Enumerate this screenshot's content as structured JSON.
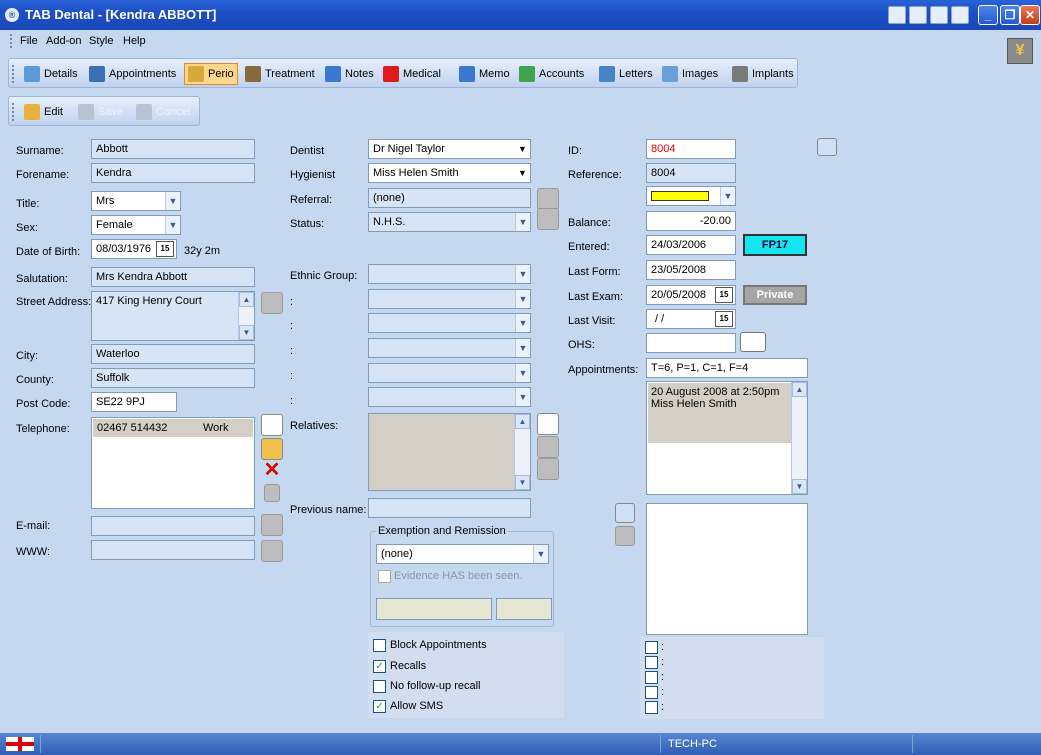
{
  "window": {
    "title": "TAB Dental - [Kendra ABBOTT]"
  },
  "menu": {
    "file": "File",
    "addon": "Add-on",
    "style": "Style",
    "help": "Help"
  },
  "tabs": [
    {
      "label": "Details",
      "icon": "house-icon"
    },
    {
      "label": "Appointments",
      "icon": "calendar-icon"
    },
    {
      "label": "Perio",
      "icon": "probe-icon",
      "active": true
    },
    {
      "label": "Treatment",
      "icon": "drill-icon"
    },
    {
      "label": "Notes",
      "icon": "notes-icon"
    },
    {
      "label": "Medical",
      "icon": "red-cross-icon"
    },
    {
      "label": "Memo",
      "icon": "memo-icon"
    },
    {
      "label": "Accounts",
      "icon": "money-icon"
    },
    {
      "label": "Letters",
      "icon": "letters-icon"
    },
    {
      "label": "Images",
      "icon": "images-icon"
    },
    {
      "label": "Implants",
      "icon": "implant-icon"
    }
  ],
  "edit_toolbar": {
    "edit": "Edit",
    "save": "Save",
    "cancel": "Cancel"
  },
  "patient": {
    "surname_label": "Surname:",
    "surname": "Abbott",
    "forename_label": "Forename:",
    "forename": "Kendra",
    "title_label": "Title:",
    "title": "Mrs",
    "sex_label": "Sex:",
    "sex": "Female",
    "dob_label": "Date of Birth:",
    "dob": "08/03/1976",
    "age": "32y 2m",
    "salutation_label": "Salutation:",
    "salutation": "Mrs Kendra Abbott",
    "street_label": "Street Address:",
    "street": "417 King Henry Court",
    "city_label": "City:",
    "city": "Waterloo",
    "county_label": "County:",
    "county": "Suffolk",
    "postcode_label": "Post Code:",
    "postcode": "SE22 9PJ",
    "telephone_label": "Telephone:",
    "telephone_number": "02467 514432",
    "telephone_type": "Work",
    "email_label": "E-mail:",
    "email": "",
    "www_label": "WWW:",
    "www": ""
  },
  "clinical": {
    "dentist_label": "Dentist",
    "dentist": "Dr Nigel Taylor",
    "hygienist_label": "Hygienist",
    "hygienist": "Miss Helen Smith",
    "referral_label": "Referral:",
    "referral": "(none)",
    "status_label": "Status:",
    "status": "N.H.S.",
    "ethnic_label": "Ethnic Group:",
    "colon": ":",
    "relatives_label": "Relatives:",
    "previous_name_label": "Previous name:",
    "exemption_title": "Exemption and Remission",
    "exemption_value": "(none)",
    "evidence_label": "Evidence HAS been seen.",
    "block_appointments": "Block Appointments",
    "recalls": "Recalls",
    "no_followup": "No follow-up recall",
    "allow_sms": "Allow SMS"
  },
  "account": {
    "id_label": "ID:",
    "id": "8004",
    "reference_label": "Reference:",
    "reference": "8004",
    "balance_label": "Balance:",
    "balance": "-20.00",
    "entered_label": "Entered:",
    "entered": "24/03/2006",
    "fp17": "FP17",
    "lastform_label": "Last Form:",
    "lastform": "23/05/2008",
    "lastexam_label": "Last Exam:",
    "lastexam": "20/05/2008",
    "private": "Private",
    "lastvisit_label": "Last Visit:",
    "lastvisit": "/ /",
    "ohs_label": "OHS:",
    "ohs": "",
    "appointments_label": "Appointments:",
    "appointments": "T=6, P=1, C=1, F=4",
    "next_appt_date": "20 August 2008 at 2:50pm",
    "next_appt_with": "Miss Helen Smith",
    "colon": ":",
    "status_color": "#ffff00"
  },
  "statusbar": {
    "computer": "TECH-PC"
  }
}
